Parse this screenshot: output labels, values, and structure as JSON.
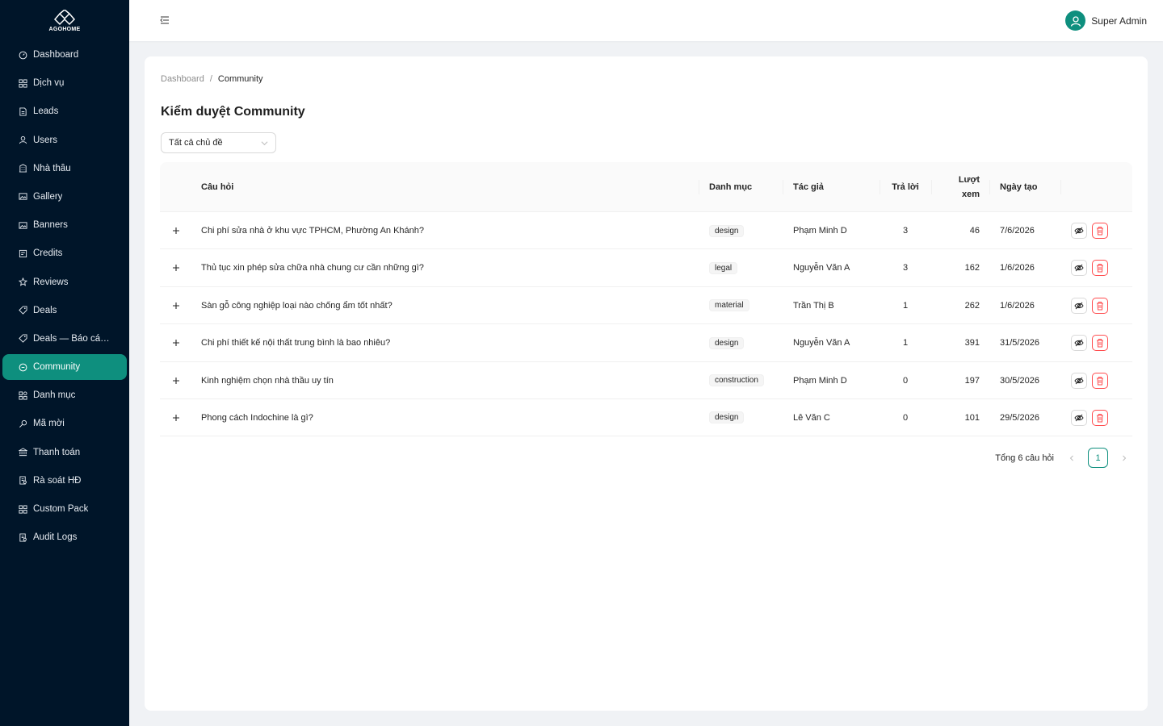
{
  "brand": {
    "name": "AGOHOME"
  },
  "sidebar": {
    "items": [
      {
        "label": "Dashboard",
        "icon": "dashboard-icon"
      },
      {
        "label": "Dịch vụ",
        "icon": "grid-icon"
      },
      {
        "label": "Leads",
        "icon": "document-icon"
      },
      {
        "label": "Users",
        "icon": "user-icon"
      },
      {
        "label": "Nhà thầu",
        "icon": "building-icon"
      },
      {
        "label": "Gallery",
        "icon": "image-icon"
      },
      {
        "label": "Banners",
        "icon": "image-icon"
      },
      {
        "label": "Credits",
        "icon": "credit-icon"
      },
      {
        "label": "Reviews",
        "icon": "star-icon"
      },
      {
        "label": "Deals",
        "icon": "tag-icon"
      },
      {
        "label": "Deals — Báo cáo ...",
        "icon": "tag-icon"
      },
      {
        "label": "Community",
        "icon": "comment-icon",
        "active": true
      },
      {
        "label": "Danh mục",
        "icon": "category-icon"
      },
      {
        "label": "Mã mời",
        "icon": "key-icon"
      },
      {
        "label": "Thanh toán",
        "icon": "bank-icon"
      },
      {
        "label": "Rà soát HĐ",
        "icon": "audit-icon"
      },
      {
        "label": "Custom Pack",
        "icon": "grid-icon"
      },
      {
        "label": "Audit Logs",
        "icon": "audit-icon"
      }
    ]
  },
  "header": {
    "user_name": "Super Admin"
  },
  "breadcrumb": {
    "home": "Dashboard",
    "separator": "/",
    "current": "Community"
  },
  "page": {
    "title": "Kiểm duyệt Community"
  },
  "filter": {
    "value": "Tất cả chủ đề"
  },
  "table": {
    "columns": {
      "question": "Câu hỏi",
      "category": "Danh mục",
      "author": "Tác giả",
      "replies": "Trả lời",
      "views_line1": "Lượt",
      "views_line2": "xem",
      "created": "Ngày tạo"
    },
    "rows": [
      {
        "question": "Chi phí sửa nhà ở khu vực TPHCM, Phường An Khánh?",
        "category": "design",
        "author": "Phạm Minh D",
        "replies": "3",
        "views": "46",
        "created": "7/6/2026"
      },
      {
        "question": "Thủ tục xin phép sửa chữa nhà chung cư cần những gì?",
        "category": "legal",
        "author": "Nguyễn Văn A",
        "replies": "3",
        "views": "162",
        "created": "1/6/2026"
      },
      {
        "question": "Sàn gỗ công nghiệp loại nào chống ẩm tốt nhất?",
        "category": "material",
        "author": "Trần Thị B",
        "replies": "1",
        "views": "262",
        "created": "1/6/2026"
      },
      {
        "question": "Chi phí thiết kế nội thất trung bình là bao nhiêu?",
        "category": "design",
        "author": "Nguyễn Văn A",
        "replies": "1",
        "views": "391",
        "created": "31/5/2026"
      },
      {
        "question": "Kinh nghiệm chọn nhà thầu uy tín",
        "category": "construction",
        "author": "Phạm Minh D",
        "replies": "0",
        "views": "197",
        "created": "30/5/2026"
      },
      {
        "question": "Phong cách Indochine là gì?",
        "category": "design",
        "author": "Lê Văn C",
        "replies": "0",
        "views": "101",
        "created": "29/5/2026"
      }
    ]
  },
  "pagination": {
    "total_text": "Tổng 6 câu hỏi",
    "current_page": "1"
  },
  "colors": {
    "sidebar_bg": "#001529",
    "accent": "#0e8f7e",
    "danger": "#ff4d4f"
  }
}
